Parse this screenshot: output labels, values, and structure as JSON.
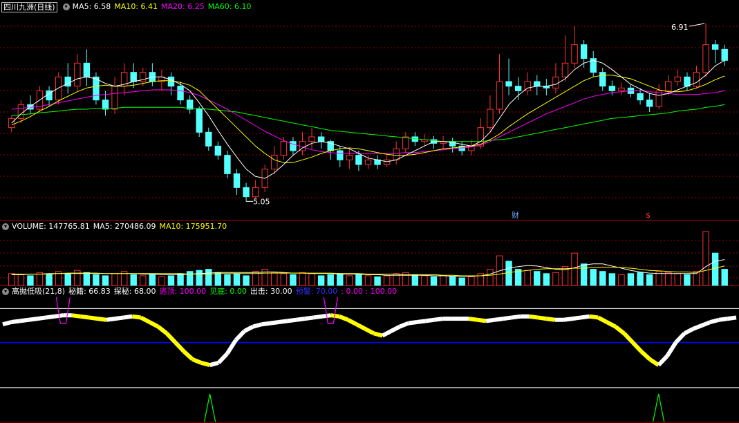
{
  "price_header": {
    "title": "四川九洲(日线)",
    "ma5": "MA5: 6.58",
    "ma10": "MA10: 6.41",
    "ma20": "MA20: 6.25",
    "ma60": "MA60: 6.10"
  },
  "volume_header": {
    "volume": "VOLUME: 147765.81",
    "ma5": "MA5: 270486.09",
    "ma10": "MA10: 175951.70"
  },
  "indicator_header": {
    "name": "高抛低吸(21,8)",
    "mijie": "秘籍: 66.83",
    "tanmi": "探秘: 68.00",
    "taoding": "逃顶: 100.00",
    "jiandi": "见底: 0.00",
    "chuji": "出击: 30.00",
    "yujing": "预警: 70.00",
    "extra": ": 0.00 : 100.00"
  },
  "colors": {
    "up": "#ff3232",
    "down": "#54ffff",
    "ma5": "#ffffff",
    "ma10": "#ffff00",
    "ma20": "#ff00ff",
    "ma60": "#00ff00",
    "grid": "#9b0000",
    "divider": "#c00000",
    "blue_line": "#0000ff",
    "sell_text": "#00ff00"
  },
  "chart_data": {
    "type": "candlestick",
    "ylim_price": [
      4.85,
      7.1
    ],
    "high_marker": "6.91",
    "low_marker": "5.05",
    "event_markers": [
      "财",
      "$"
    ],
    "candles": [
      [
        5.85,
        5.95,
        5.8,
        5.98
      ],
      [
        5.95,
        6.1,
        5.9,
        6.15
      ],
      [
        6.1,
        6.05,
        6.0,
        6.2
      ],
      [
        6.05,
        6.25,
        6.02,
        6.3
      ],
      [
        6.25,
        6.15,
        6.08,
        6.3
      ],
      [
        6.15,
        6.4,
        6.1,
        6.45
      ],
      [
        6.4,
        6.3,
        6.22,
        6.55
      ],
      [
        6.3,
        6.55,
        6.25,
        6.65
      ],
      [
        6.55,
        6.4,
        6.3,
        6.7
      ],
      [
        6.4,
        6.15,
        6.1,
        6.45
      ],
      [
        6.15,
        6.05,
        5.98,
        6.25
      ],
      [
        6.05,
        6.3,
        6.0,
        6.4
      ],
      [
        6.3,
        6.45,
        6.2,
        6.55
      ],
      [
        6.45,
        6.35,
        6.28,
        6.55
      ],
      [
        6.35,
        6.45,
        6.3,
        6.5
      ],
      [
        6.45,
        6.35,
        6.3,
        6.55
      ],
      [
        6.35,
        6.4,
        6.25,
        6.48
      ],
      [
        6.4,
        6.3,
        6.2,
        6.45
      ],
      [
        6.3,
        6.15,
        6.1,
        6.35
      ],
      [
        6.15,
        6.05,
        6.0,
        6.2
      ],
      [
        6.05,
        5.8,
        5.75,
        6.08
      ],
      [
        5.8,
        5.65,
        5.6,
        5.85
      ],
      [
        5.65,
        5.55,
        5.5,
        5.7
      ],
      [
        5.55,
        5.35,
        5.3,
        5.6
      ],
      [
        5.35,
        5.2,
        5.12,
        5.4
      ],
      [
        5.2,
        5.1,
        5.05,
        5.25
      ],
      [
        5.1,
        5.2,
        5.08,
        5.28
      ],
      [
        5.2,
        5.4,
        5.15,
        5.45
      ],
      [
        5.4,
        5.55,
        5.35,
        5.65
      ],
      [
        5.55,
        5.7,
        5.5,
        5.75
      ],
      [
        5.7,
        5.6,
        5.55,
        5.75
      ],
      [
        5.6,
        5.7,
        5.55,
        5.8
      ],
      [
        5.7,
        5.75,
        5.62,
        5.85
      ],
      [
        5.75,
        5.7,
        5.62,
        5.8
      ],
      [
        5.7,
        5.6,
        5.5,
        5.72
      ],
      [
        5.6,
        5.5,
        5.42,
        5.65
      ],
      [
        5.5,
        5.55,
        5.4,
        5.62
      ],
      [
        5.55,
        5.45,
        5.38,
        5.6
      ],
      [
        5.45,
        5.5,
        5.4,
        5.55
      ],
      [
        5.5,
        5.45,
        5.4,
        5.55
      ],
      [
        5.45,
        5.5,
        5.42,
        5.55
      ],
      [
        5.5,
        5.62,
        5.45,
        5.7
      ],
      [
        5.62,
        5.75,
        5.58,
        5.8
      ],
      [
        5.75,
        5.7,
        5.65,
        5.8
      ],
      [
        5.7,
        5.72,
        5.65,
        5.78
      ],
      [
        5.72,
        5.68,
        5.62,
        5.76
      ],
      [
        5.68,
        5.7,
        5.62,
        5.76
      ],
      [
        5.7,
        5.65,
        5.58,
        5.74
      ],
      [
        5.65,
        5.6,
        5.55,
        5.7
      ],
      [
        5.6,
        5.65,
        5.55,
        5.72
      ],
      [
        5.65,
        5.85,
        5.62,
        5.95
      ],
      [
        5.85,
        6.05,
        5.8,
        6.2
      ],
      [
        6.05,
        6.35,
        6.0,
        6.65
      ],
      [
        6.35,
        6.3,
        6.2,
        6.6
      ],
      [
        6.3,
        6.25,
        6.15,
        6.4
      ],
      [
        6.25,
        6.35,
        6.2,
        6.45
      ],
      [
        6.35,
        6.3,
        6.2,
        6.42
      ],
      [
        6.3,
        6.28,
        6.2,
        6.38
      ],
      [
        6.28,
        6.4,
        6.22,
        6.55
      ],
      [
        6.4,
        6.55,
        6.35,
        6.85
      ],
      [
        6.55,
        6.75,
        6.5,
        6.95
      ],
      [
        6.75,
        6.6,
        6.5,
        6.8
      ],
      [
        6.6,
        6.45,
        6.4,
        6.68
      ],
      [
        6.45,
        6.3,
        6.25,
        6.5
      ],
      [
        6.3,
        6.25,
        6.2,
        6.36
      ],
      [
        6.25,
        6.28,
        6.2,
        6.34
      ],
      [
        6.28,
        6.22,
        6.18,
        6.32
      ],
      [
        6.22,
        6.15,
        6.1,
        6.28
      ],
      [
        6.15,
        6.08,
        6.02,
        6.22
      ],
      [
        6.08,
        6.25,
        6.05,
        6.32
      ],
      [
        6.25,
        6.35,
        6.2,
        6.42
      ],
      [
        6.35,
        6.4,
        6.3,
        6.48
      ],
      [
        6.4,
        6.3,
        6.25,
        6.45
      ],
      [
        6.3,
        6.45,
        6.28,
        6.52
      ],
      [
        6.45,
        6.75,
        6.4,
        6.98
      ],
      [
        6.75,
        6.7,
        6.55,
        6.8
      ],
      [
        6.7,
        6.58,
        6.52,
        6.75
      ]
    ],
    "ma5": [
      5.9,
      6.0,
      6.08,
      6.15,
      6.22,
      6.28,
      6.33,
      6.38,
      6.4,
      6.38,
      6.33,
      6.3,
      6.32,
      6.35,
      6.37,
      6.4,
      6.4,
      6.37,
      6.32,
      6.25,
      6.12,
      5.98,
      5.82,
      5.67,
      5.53,
      5.4,
      5.32,
      5.3,
      5.36,
      5.45,
      5.55,
      5.63,
      5.68,
      5.7,
      5.68,
      5.65,
      5.62,
      5.57,
      5.52,
      5.5,
      5.48,
      5.5,
      5.55,
      5.6,
      5.65,
      5.7,
      5.7,
      5.69,
      5.67,
      5.65,
      5.7,
      5.8,
      5.95,
      6.1,
      6.2,
      6.28,
      6.3,
      6.3,
      6.32,
      6.38,
      6.48,
      6.55,
      6.58,
      6.55,
      6.48,
      6.4,
      6.32,
      6.27,
      6.22,
      6.2,
      6.22,
      6.26,
      6.3,
      6.34,
      6.42,
      6.52,
      6.58
    ],
    "ma10": [
      5.88,
      5.92,
      5.97,
      6.03,
      6.08,
      6.14,
      6.19,
      6.24,
      6.28,
      6.3,
      6.31,
      6.3,
      6.3,
      6.31,
      6.33,
      6.35,
      6.36,
      6.36,
      6.34,
      6.31,
      6.25,
      6.15,
      6.05,
      5.95,
      5.85,
      5.75,
      5.65,
      5.57,
      5.5,
      5.47,
      5.47,
      5.5,
      5.53,
      5.57,
      5.6,
      5.62,
      5.63,
      5.62,
      5.6,
      5.58,
      5.56,
      5.55,
      5.55,
      5.56,
      5.58,
      5.6,
      5.62,
      5.63,
      5.64,
      5.65,
      5.67,
      5.72,
      5.78,
      5.86,
      5.93,
      6.0,
      6.06,
      6.12,
      6.18,
      6.24,
      6.3,
      6.36,
      6.4,
      6.42,
      6.42,
      6.4,
      6.38,
      6.34,
      6.3,
      6.26,
      6.24,
      6.24,
      6.25,
      6.28,
      6.32,
      6.37,
      6.41
    ],
    "ma20": [
      6.05,
      6.06,
      6.07,
      6.08,
      6.1,
      6.12,
      6.14,
      6.16,
      6.18,
      6.2,
      6.21,
      6.22,
      6.23,
      6.24,
      6.25,
      6.26,
      6.26,
      6.26,
      6.25,
      6.23,
      6.2,
      6.15,
      6.1,
      6.05,
      5.99,
      5.93,
      5.87,
      5.81,
      5.76,
      5.71,
      5.67,
      5.64,
      5.61,
      5.59,
      5.58,
      5.57,
      5.57,
      5.57,
      5.57,
      5.57,
      5.57,
      5.57,
      5.58,
      5.58,
      5.59,
      5.6,
      5.61,
      5.62,
      5.63,
      5.64,
      5.66,
      5.7,
      5.75,
      5.8,
      5.85,
      5.9,
      5.95,
      6.0,
      6.04,
      6.08,
      6.12,
      6.16,
      6.19,
      6.21,
      6.23,
      6.24,
      6.25,
      6.25,
      6.24,
      6.23,
      6.22,
      6.21,
      6.21,
      6.21,
      6.22,
      6.23,
      6.25
    ],
    "ma60": [
      5.98,
      5.99,
      6.0,
      6.01,
      6.02,
      6.03,
      6.04,
      6.05,
      6.05,
      6.06,
      6.06,
      6.06,
      6.07,
      6.07,
      6.07,
      6.07,
      6.07,
      6.07,
      6.07,
      6.06,
      6.06,
      6.05,
      6.04,
      6.03,
      6.02,
      6.0,
      5.98,
      5.96,
      5.94,
      5.92,
      5.9,
      5.88,
      5.86,
      5.84,
      5.82,
      5.81,
      5.8,
      5.79,
      5.78,
      5.77,
      5.76,
      5.75,
      5.74,
      5.73,
      5.72,
      5.71,
      5.7,
      5.7,
      5.7,
      5.7,
      5.7,
      5.71,
      5.72,
      5.73,
      5.75,
      5.77,
      5.79,
      5.81,
      5.83,
      5.85,
      5.87,
      5.89,
      5.91,
      5.93,
      5.95,
      5.96,
      5.97,
      5.98,
      5.99,
      6.0,
      6.01,
      6.03,
      6.04,
      6.05,
      6.07,
      6.08,
      6.1
    ],
    "volume": [
      22,
      20,
      18,
      24,
      20,
      26,
      22,
      28,
      24,
      20,
      18,
      22,
      26,
      20,
      18,
      20,
      16,
      18,
      22,
      26,
      28,
      30,
      24,
      20,
      22,
      18,
      26,
      30,
      24,
      22,
      20,
      24,
      22,
      18,
      20,
      22,
      18,
      20,
      18,
      16,
      18,
      22,
      24,
      20,
      18,
      16,
      18,
      16,
      14,
      16,
      22,
      30,
      55,
      45,
      30,
      28,
      26,
      22,
      24,
      35,
      60,
      40,
      30,
      26,
      22,
      20,
      22,
      24,
      20,
      26,
      24,
      22,
      20,
      26,
      100,
      60,
      30
    ],
    "vol_ma5": [
      20,
      20,
      21,
      21,
      22,
      22,
      23,
      23,
      23,
      23,
      22,
      22,
      22,
      22,
      21,
      21,
      20,
      20,
      20,
      21,
      22,
      23,
      24,
      24,
      24,
      24,
      24,
      25,
      25,
      24,
      23,
      23,
      22,
      22,
      22,
      21,
      21,
      21,
      20,
      20,
      19,
      19,
      19,
      19,
      19,
      18,
      18,
      17,
      17,
      17,
      18,
      21,
      27,
      32,
      35,
      37,
      36,
      33,
      30,
      29,
      33,
      38,
      40,
      40,
      36,
      32,
      28,
      25,
      23,
      22,
      22,
      22,
      22,
      22,
      35,
      45,
      48
    ],
    "vol_ma10": [
      21,
      21,
      21,
      21,
      21,
      22,
      22,
      22,
      22,
      22,
      22,
      22,
      22,
      22,
      22,
      22,
      22,
      22,
      22,
      21,
      21,
      21,
      22,
      22,
      22,
      22,
      22,
      23,
      23,
      23,
      23,
      23,
      23,
      23,
      23,
      22,
      22,
      22,
      21,
      21,
      21,
      21,
      20,
      20,
      20,
      20,
      19,
      19,
      18,
      18,
      18,
      19,
      21,
      24,
      26,
      28,
      30,
      31,
      31,
      31,
      32,
      32,
      33,
      34,
      34,
      33,
      32,
      30,
      28,
      27,
      26,
      25,
      25,
      24,
      28,
      32,
      36
    ],
    "indicator": [
      86,
      88,
      89,
      90,
      91,
      92,
      93,
      94,
      94,
      93,
      92,
      91,
      90,
      91,
      92,
      93,
      92,
      88,
      84,
      78,
      70,
      62,
      55,
      52,
      50,
      52,
      60,
      72,
      80,
      84,
      86,
      87,
      88,
      89,
      90,
      91,
      92,
      93,
      94,
      93,
      90,
      86,
      82,
      78,
      76,
      80,
      84,
      87,
      88,
      89,
      90,
      91,
      91,
      91,
      91,
      90,
      89,
      90,
      91,
      92,
      93,
      93,
      92,
      91,
      90,
      90,
      91,
      92,
      93,
      92,
      88,
      84,
      78,
      70,
      62,
      55,
      50,
      58,
      70,
      78,
      82,
      85,
      88,
      90,
      91,
      92
    ]
  }
}
